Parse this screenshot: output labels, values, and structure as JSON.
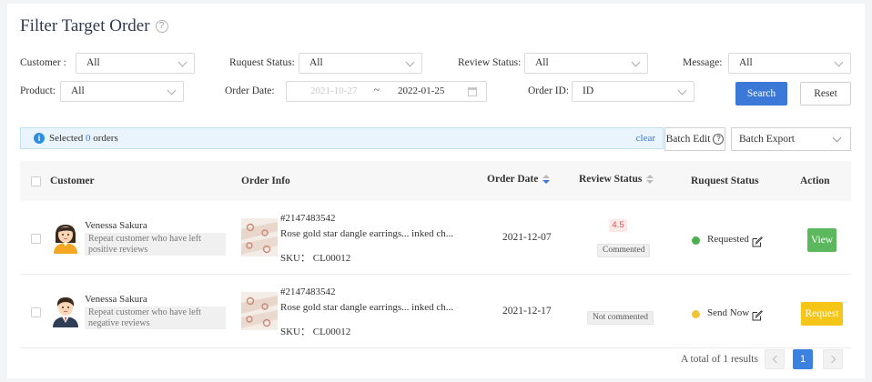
{
  "page": {
    "title": "Filter Target Order"
  },
  "filters": {
    "customer": {
      "label": "Customer :",
      "value": "All"
    },
    "request_status": {
      "label": "Ruquest Status:",
      "value": "All"
    },
    "review_status": {
      "label": "Review Status:",
      "value": "All"
    },
    "message": {
      "label": "Message:",
      "value": "All"
    },
    "product": {
      "label": "Product:",
      "value": "All"
    },
    "order_date": {
      "label": "Order Date:",
      "start": "2021-10-27",
      "separator": "~",
      "end": "2022-01-25"
    },
    "order_id": {
      "label": "Order ID:",
      "value": "ID"
    },
    "search_label": "Search",
    "reset_label": "Reset"
  },
  "selection": {
    "prefix": "Selected",
    "count": "0",
    "suffix": "orders",
    "clear_label": "clear"
  },
  "toolbar": {
    "batch_edit": "Batch Edit",
    "batch_export": "Batch Export"
  },
  "table": {
    "columns": {
      "customer": "Customer",
      "order_info": "Order Info",
      "order_date": "Order Date",
      "review_status": "Review Status",
      "request_status": "Ruquest Status",
      "action": "Action"
    },
    "rows": [
      {
        "customer_name": "Venessa Sakura",
        "customer_tag": "Repeat customer who have left positive reviews",
        "order_id": "#2147483542",
        "product": "Rose gold star dangle earrings... inked ch...",
        "sku": "SKU： CL00012",
        "date": "2021-12-07",
        "rating": "4.5",
        "review_status": "Commented",
        "request_status": "Requested",
        "status_color": "#4caf50",
        "action": "View",
        "action_color": "#5cb85c"
      },
      {
        "customer_name": "Venessa Sakura",
        "customer_tag": "Repeat customer who have left negative reviews",
        "order_id": "#2147483542",
        "product": "Rose gold star dangle earrings... inked ch...",
        "sku": "SKU： CL00012",
        "date": "2021-12-17",
        "review_status": "Not commented",
        "request_status": "Send Now",
        "status_color": "#f0c43a",
        "action": "Request",
        "action_color": "#f5c518"
      }
    ]
  },
  "pagination": {
    "summary": "A total of 1 results",
    "current_page": "1"
  }
}
